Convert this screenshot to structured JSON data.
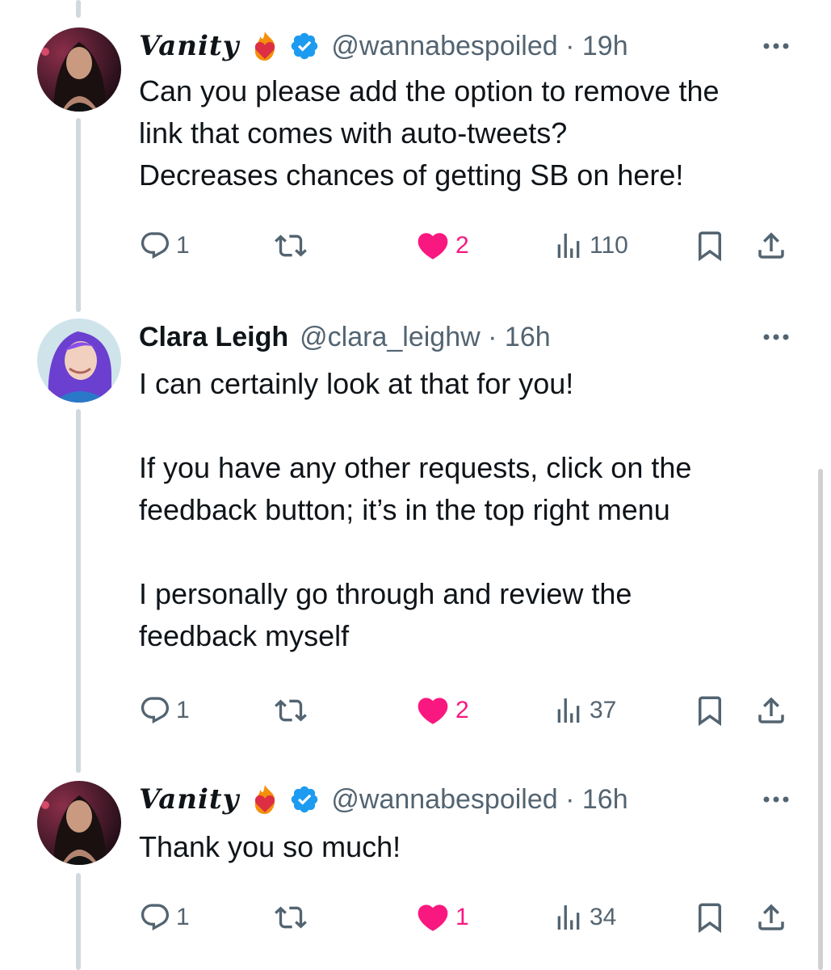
{
  "tweets": [
    {
      "name": "Vanity",
      "emoji": "fire-heart-emoji",
      "verified": true,
      "handle": "@wannabespoiled",
      "time": "19h",
      "body": "Can you please add the option to remove the\nlink that comes with auto-tweets?\nDecreases chances of getting SB on here!",
      "replies": "1",
      "reposts": "",
      "likes": "2",
      "views": "110",
      "liked": true
    },
    {
      "name": "Clara Leigh",
      "verified": false,
      "handle": "@clara_leighw",
      "time": "16h",
      "body": "I can certainly look at that for you!\n\nIf you have any other requests, click on the\nfeedback button; it’s in the top right menu\n\nI personally go through and review the\nfeedback myself",
      "replies": "1",
      "reposts": "",
      "likes": "2",
      "views": "37",
      "liked": true
    },
    {
      "name": "Vanity",
      "emoji": "fire-heart-emoji",
      "verified": true,
      "handle": "@wannabespoiled",
      "time": "16h",
      "body": "Thank you so much!",
      "replies": "1",
      "reposts": "",
      "likes": "1",
      "views": "34",
      "liked": true
    }
  ],
  "separator": " · ",
  "colors": {
    "like": "#f91880",
    "verified": "#1d9bf0",
    "secondary": "#536471",
    "thread": "#cfd9de"
  },
  "icons": [
    "reply-icon",
    "repost-icon",
    "like-icon",
    "views-icon",
    "bookmark-icon",
    "share-icon",
    "more-icon",
    "verified-icon"
  ]
}
